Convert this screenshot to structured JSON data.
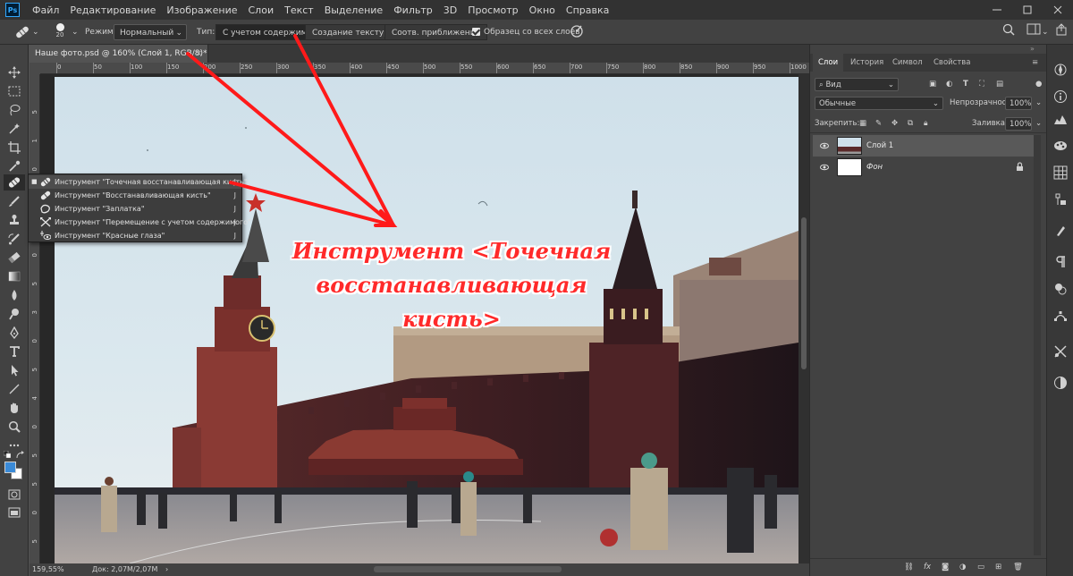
{
  "app": {
    "logo": "Ps",
    "menu": [
      "Файл",
      "Редактирование",
      "Изображение",
      "Слои",
      "Текст",
      "Выделение",
      "Фильтр",
      "3D",
      "Просмотр",
      "Окно",
      "Справка"
    ],
    "window_controls": [
      "minimize-icon",
      "maximize-icon",
      "close-icon"
    ]
  },
  "options": {
    "brush_size": "20",
    "mode_label": "Режим:",
    "mode_value": "Нормальный",
    "type_label": "Тип:",
    "type_buttons": [
      "С учетом содержимого",
      "Создание текстуры",
      "Соотв. приближения"
    ],
    "sample_all": "Образец со всех слоев"
  },
  "document": {
    "tab_title": "Наше фото.psd @ 160% (Слой 1, RGB/8)",
    "tab_modified": "*",
    "ruler_h": [
      "0",
      "50",
      "100",
      "150",
      "200",
      "250",
      "300",
      "350",
      "400",
      "450",
      "500",
      "550",
      "600",
      "650",
      "700",
      "750",
      "800",
      "850",
      "900",
      "950",
      "1000",
      "1050",
      "1100"
    ],
    "ruler_v": [
      "5",
      "1",
      "0",
      "5",
      "2",
      "0",
      "5",
      "3",
      "0",
      "5",
      "4",
      "0",
      "5",
      "5",
      "0",
      "5"
    ],
    "zoom": "159,55%",
    "doc_info": "Док: 2,07M/2,07M"
  },
  "flyout": {
    "items": [
      {
        "label": "Инструмент \"Точечная восстанавливающая кисть\"",
        "key": "J",
        "active": true
      },
      {
        "label": "Инструмент \"Восстанавливающая кисть\"",
        "key": "J"
      },
      {
        "label": "Инструмент \"Заплатка\"",
        "key": "J"
      },
      {
        "label": "Инструмент \"Перемещение с учетом содержимого\"",
        "key": "J"
      },
      {
        "label": "Инструмент \"Красные глаза\"",
        "key": "J"
      }
    ]
  },
  "annotation": {
    "line1": "Инструмент <Точечная",
    "line2": "восстанавливающая кисть>",
    "color": "#ff1a1a"
  },
  "panels": {
    "tabs": [
      "Слои",
      "История",
      "Символ",
      "Свойства"
    ],
    "filter_value": "Вид",
    "blend_mode": "Обычные",
    "opacity_label": "Непрозрачность:",
    "opacity_value": "100%",
    "lock_label": "Закрепить:",
    "fill_label": "Заливка:",
    "fill_value": "100%",
    "layers": [
      {
        "name": "Слой 1",
        "selected": true
      },
      {
        "name": "Фон",
        "locked": true
      }
    ],
    "bottom_fx": "fx"
  },
  "colors": {
    "accent": "#31a8ff",
    "foreground": "#3a8ad7",
    "background": "#ffffff"
  }
}
